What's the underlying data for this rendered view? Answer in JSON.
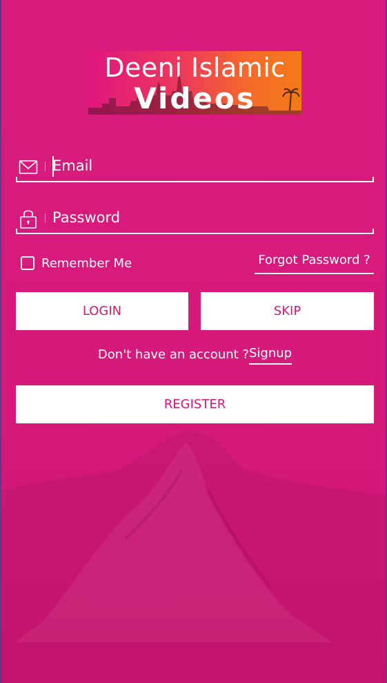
{
  "logo": {
    "line1": "Deeni Islamic",
    "line2": "Videos"
  },
  "email_field": {
    "placeholder": "Email",
    "value": "",
    "icon": "envelope-icon"
  },
  "password_field": {
    "placeholder": "Password",
    "value": "",
    "icon": "lock-icon"
  },
  "remember_me": {
    "label": "Remember Me",
    "checked": false
  },
  "forgot_password": "Forgot Password ?",
  "buttons": {
    "login": "LOGIN",
    "skip": "SKIP",
    "register": "REGISTER"
  },
  "signup": {
    "prompt": "Don't have an account ?",
    "link": "Signup"
  },
  "colors": {
    "background": "#d61a7b",
    "button_text": "#d0177a",
    "button_bg": "#ffffff",
    "text": "#ffffff"
  }
}
